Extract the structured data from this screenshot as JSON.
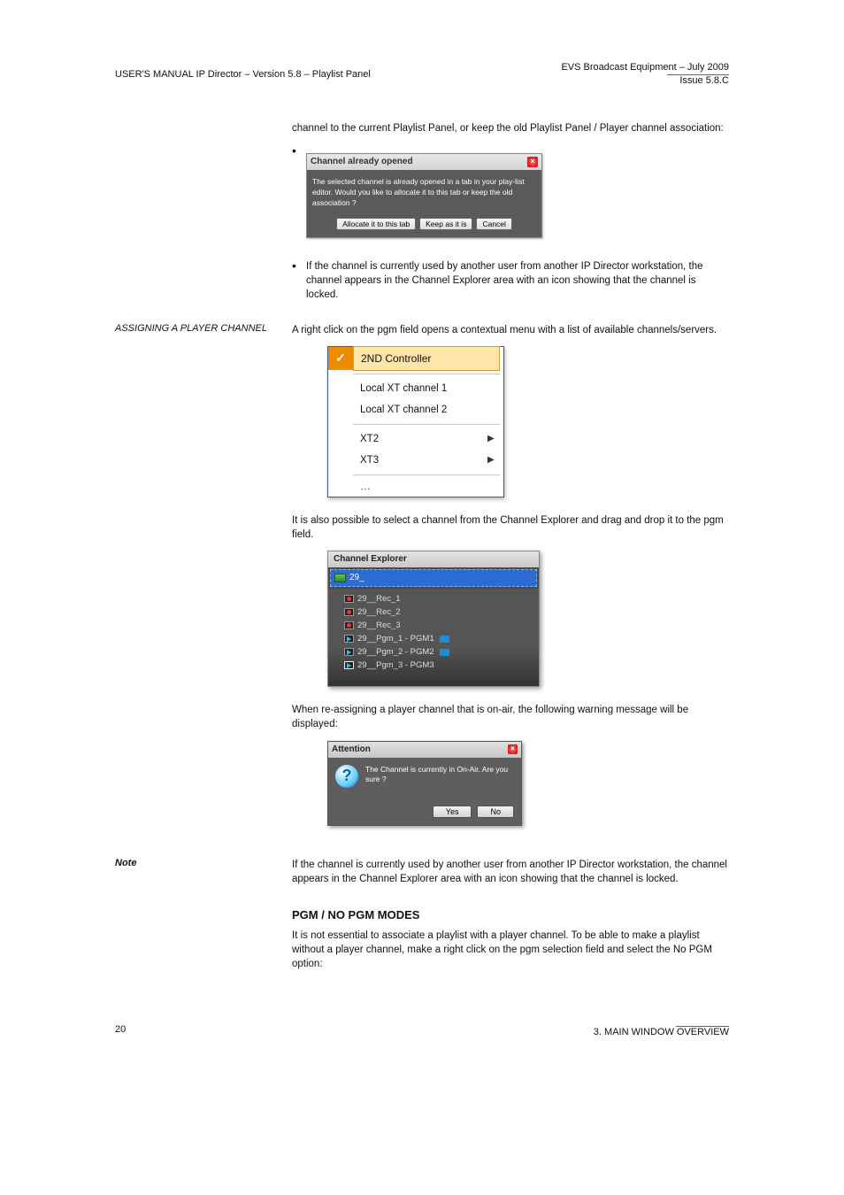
{
  "header": {
    "left": "USER'S MANUAL  IP Director – Version 5.8 – Playlist Panel",
    "right_top": "EVS Broadcast Equipment – July 2009",
    "right_bottom": "Issue 5.8.C"
  },
  "para1": "channel to the current Playlist Panel, or keep the old Playlist Panel / Player channel association:",
  "dlg1": {
    "title": "Channel already opened",
    "message": "The selected channel is already opened in a tab in your play-list editor. Would you like to allocate it to this tab or keep the old association ?",
    "btn_allocate": "Allocate it to this tab",
    "btn_keep": "Keep as it is",
    "btn_cancel": "Cancel"
  },
  "para2": "If the channel is currently used by another user from another IP Director workstation, the channel appears in the Channel Explorer area with an icon showing that the channel is locked.",
  "heading_assigning": "ASSIGNING A PLAYER CHANNEL",
  "para3": "A right click on the pgm field opens a contextual menu with a list of available channels/servers.",
  "menu": {
    "items": [
      {
        "label": "2ND Controller",
        "checked": true
      },
      {
        "label": "Local XT channel 1"
      },
      {
        "label": "Local XT channel 2"
      },
      {
        "label": "XT2",
        "submenu": true
      },
      {
        "label": "XT3",
        "submenu": true
      }
    ],
    "more": "…"
  },
  "para4": "It is also possible to select a channel from the Channel Explorer and drag and drop it to the pgm field.",
  "tree": {
    "title": "Channel Explorer",
    "root": "29_",
    "nodes": [
      {
        "type": "rec",
        "label": "29__Rec_1"
      },
      {
        "type": "rec",
        "label": "29__Rec_2"
      },
      {
        "type": "rec",
        "label": "29__Rec_3"
      },
      {
        "type": "play",
        "label": "29__Pgm_1 - PGM1",
        "cam": true
      },
      {
        "type": "play",
        "label": "29__Pgm_2 - PGM2",
        "cam": true
      },
      {
        "type": "play",
        "label": "29__Pgm_3 - PGM3",
        "boxed": true
      }
    ]
  },
  "para5": "When re-assigning a player channel that is on-air, the following warning message will be displayed:",
  "dlg2": {
    "title": "Attention",
    "message": "The Channel is currently in On-Air. Are you sure ?",
    "btn_yes": "Yes",
    "btn_no": "No"
  },
  "note_label": "Note",
  "note_body": "If the channel is currently used by another user from another IP Director workstation, the channel appears in the Channel Explorer area with an icon showing that the channel is locked.",
  "heading_pgm": "PGM / NO PGM MODES",
  "para6": "It is not essential to associate a playlist with a player channel. To be able to make a playlist without a player channel, make a right click on the pgm selection field and select the No PGM option:",
  "footer": {
    "left": "20",
    "right": "3. MAIN WINDOW OVERVIEW"
  }
}
